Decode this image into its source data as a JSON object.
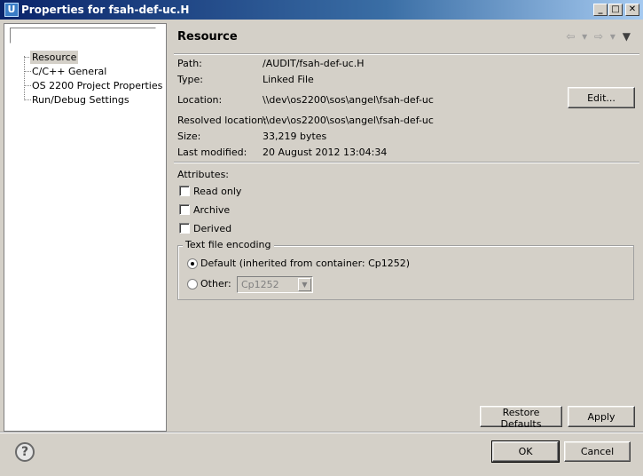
{
  "window": {
    "title": "Properties for fsah-def-uc.H",
    "icon": "U",
    "controls": {
      "minimize": "_",
      "maximize": "□",
      "close": "✕"
    }
  },
  "sidebar": {
    "filter_value": "",
    "items": [
      {
        "label": "Resource",
        "selected": true
      },
      {
        "label": "C/C++ General",
        "selected": false
      },
      {
        "label": "OS 2200 Project Properties",
        "selected": false
      },
      {
        "label": "Run/Debug Settings",
        "selected": false
      }
    ]
  },
  "page": {
    "title": "Resource",
    "nav": {
      "back": "⇦",
      "back_menu": "▾",
      "forward": "⇨",
      "forward_menu": "▾",
      "view_menu": "▼"
    }
  },
  "info": {
    "path_label": "Path:",
    "path_value": "/AUDIT/fsah-def-uc.H",
    "type_label": "Type:",
    "type_value": "Linked File",
    "location_label": "Location:",
    "location_value": "\\\\dev\\os2200\\sos\\angel\\fsah-def-uc",
    "resolved_label": "Resolved location:",
    "resolved_value": "\\\\dev\\os2200\\sos\\angel\\fsah-def-uc",
    "size_label": "Size:",
    "size_value": "33,219  bytes",
    "modified_label": "Last modified:",
    "modified_value": "20 August 2012 13:04:34",
    "edit_button": "Edit..."
  },
  "attributes": {
    "heading": "Attributes:",
    "read_only": "Read only",
    "archive": "Archive",
    "derived": "Derived"
  },
  "encoding": {
    "legend": "Text file encoding",
    "default_label": "Default (inherited from container: Cp1252)",
    "other_label": "Other:",
    "other_value": "Cp1252",
    "selected": "default"
  },
  "buttons": {
    "restore_defaults": "Restore Defaults",
    "apply": "Apply",
    "ok": "OK",
    "cancel": "Cancel",
    "help": "?"
  }
}
